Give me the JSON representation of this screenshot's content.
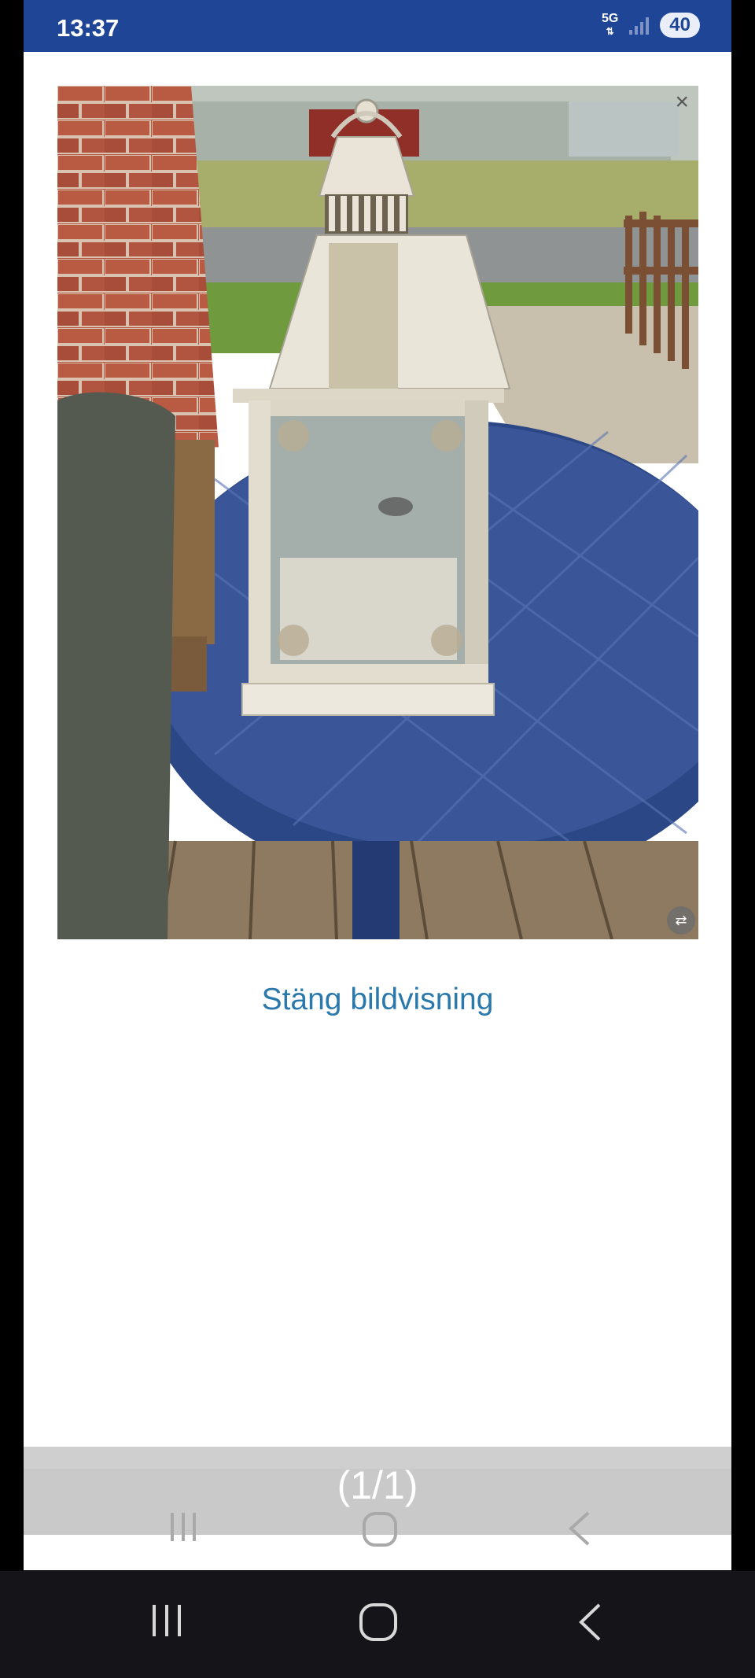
{
  "status_bar": {
    "time": "13:37",
    "network": "5G",
    "battery": "40",
    "bg_color": "#1f4596"
  },
  "viewer": {
    "close_icon": "×",
    "close_icon_name": "close-icon",
    "zoom_icon_name": "swap-icon",
    "close_link": "Stäng bildvisning",
    "counter": "(1/1)",
    "link_color": "#2b79ac"
  },
  "nav": {
    "recents_icon": "recents-icon",
    "home_icon": "home-icon",
    "back_icon": "back-icon"
  }
}
